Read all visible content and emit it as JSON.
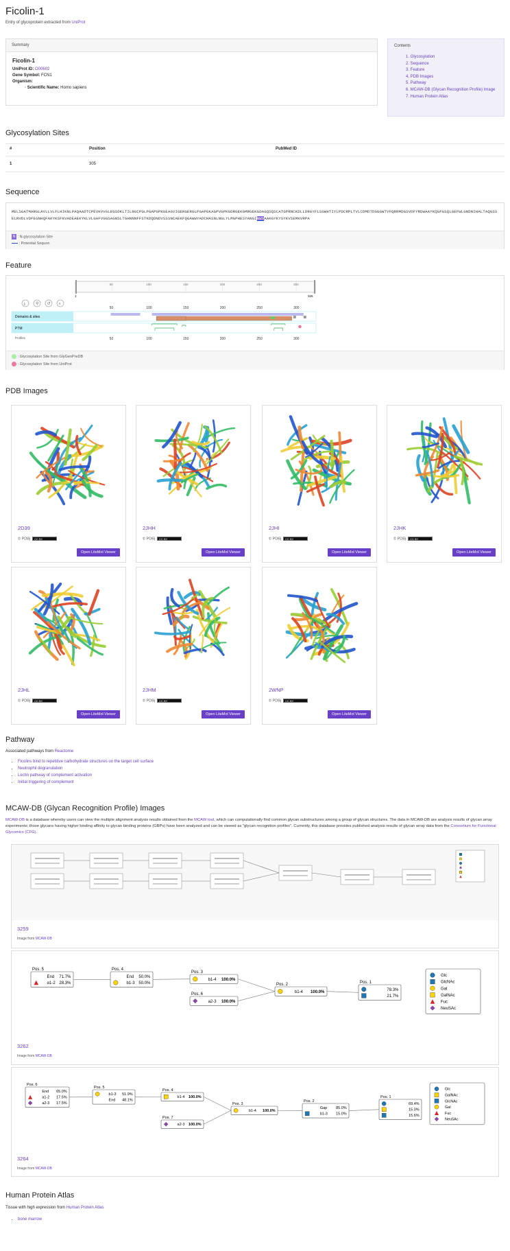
{
  "title": "Ficolin-1",
  "subtitle_prefix": "Entry of glycoprotein extracted from",
  "subtitle_link": "UniProt",
  "summary": {
    "header": "Summary",
    "name": "Ficolin-1",
    "uniprot_label": "UniProt ID:",
    "uniprot_id": "O00602",
    "gene_label": "Gene Symbol:",
    "gene": "FCN1",
    "organism_label": "Organism:",
    "sci_label": "Scientific Name:",
    "sci_name": "Homo sapiens"
  },
  "contents": {
    "header": "Contents",
    "items": [
      "1. Glycosylation",
      "2. Sequence",
      "3. Feature",
      "4. PDB Images",
      "5. Pathway",
      "6. MCAW-DB (Glycan Recognition Profile) Image",
      "7. Human Protein Atlas"
    ]
  },
  "glyco": {
    "heading": "Glycosylation Sites",
    "cols": [
      "#",
      "Position",
      "PubMed ID"
    ],
    "rows": [
      [
        "1",
        "305",
        ""
      ]
    ]
  },
  "sequence": {
    "heading": "Sequence",
    "pre": "MELSGATMARGLAVLLVLFLHIKNLPAQAADTCPEVKVVGLEGSDKLTILRGCPGLPGAPGPKGEAGVIGERGERGLPGAPGKAGPVGPKGDRGEKGMRGEKGDAGQSQSCATGPRNCKDLLDRGYFLSGWHTIYLPDCRPLTVLCDMDTDGGGWTVFQRRMDGSVDFYRDWAAYKQGFGSQLGEFWLGNDNIHALTAQGSSELRVDLVDFEGNHQFAKYKSFKVADEAEKYKLVLGAFVGGSAGNSLTGHNNNFFSTKDQDNDVSSSNCAEKFQGAWWYADCHASNLNGLYLMGPHESYANGINWSAAKGYKYSYKVSEMKVRPA",
    "site": "NWS",
    "post": "AAKGYKYSYKVSEMKVRPA",
    "legend_site": ": N-glycosylation Site",
    "legend_seq": ": Potential Sequon"
  },
  "feature": {
    "heading": "Feature",
    "axis_ticks": [
      "50",
      "100",
      "150",
      "200",
      "250",
      "300"
    ],
    "axis_start": "1",
    "axis_end": "326",
    "tracks": [
      "Domains & sites",
      "PTM"
    ],
    "profiles": "Profiles",
    "legend_gp": ": Glycosylation Site from GlyGenPreDB",
    "legend_up": ": Glycosylation Site from UniProt",
    "colors": {
      "domain": "#d9906a",
      "region": "#b9b9ee",
      "gp": "#66cc66",
      "up": "#e87aa0",
      "track": "#bff0f8"
    }
  },
  "pdb": {
    "heading": "PDB Images",
    "source": "© PDBj",
    "license": "CC BY",
    "button": "Open LiteMol Viewer",
    "entries": [
      "2D39",
      "2JHH",
      "2JHI",
      "2JHK",
      "2JHL",
      "2JHM",
      "2WNP"
    ]
  },
  "pathway": {
    "heading": "Pathway",
    "intro_prefix": "Associated pathways from",
    "intro_link": "Reactome",
    "items": [
      "Ficolins bind to repetitive carbohydrate structures on the target cell surface",
      "Neutrophil degranulation",
      "Lectin pathway of complement activation",
      "Initial triggering of complement"
    ]
  },
  "mcaw": {
    "heading": "MCAW-DB (Glycan Recognition Profile) Images",
    "para": {
      "l1": "MCAW-DB",
      "t1": " is a database whereby users can view the multiple alignment analysis results obtained from the ",
      "l2": "MCAW tool",
      "t2": ", which can computationally find common glycan substructures among a group of glycan structures. The data in MCAW-DB are analysis results of glycan array experiments; those glycans having higher binding affinity to glycan binding proteins (GBPs) have been analyzed and can be viewed as \"glycan recognition profiles\". Currently, this database provides published analysis results of glycan array data from the ",
      "l3": "Consortium for Functional Glycomics (CFG)",
      "t3": "."
    },
    "src_prefix": "Image from",
    "src_link": "MCAW-DB",
    "profiles": [
      {
        "id": "3259"
      },
      {
        "id": "3262"
      },
      {
        "id": "3264"
      }
    ],
    "legend2": [
      "Glc",
      "GlcNAc",
      "Gal",
      "GalNAc",
      "Fuc",
      "NeuSAc"
    ],
    "legend3": [
      "Glc",
      "GalNAc",
      "GlcNAc",
      "Gal",
      "Fuc",
      "Neu5Ac"
    ],
    "p3262": {
      "pos5": {
        "t": "Pos. 5",
        "r": [
          [
            "End",
            "71.7%"
          ],
          [
            "α1-2",
            "28.3%"
          ]
        ]
      },
      "pos4": {
        "t": "Pos. 4",
        "r": [
          [
            "End",
            "50.0%"
          ],
          [
            "b1-3",
            "50.0%"
          ]
        ]
      },
      "pos3": {
        "t": "Pos. 3",
        "r": [
          [
            "b1-4",
            "100.0%"
          ]
        ]
      },
      "pos6": {
        "t": "Pos. 6",
        "r": [
          [
            "a2-3",
            "100.0%"
          ]
        ]
      },
      "pos2": {
        "t": "Pos. 2",
        "r": [
          [
            "b1-4",
            "100.0%"
          ]
        ]
      },
      "pos1": {
        "t": "Pos. 1",
        "r": [
          [
            "",
            "78.3%"
          ],
          [
            "",
            "21.7%"
          ]
        ]
      }
    },
    "p3264": {
      "pos6": {
        "t": "Pos. 6",
        "r": [
          [
            "End",
            "65.0%"
          ],
          [
            "a1-2",
            "17.5%"
          ],
          [
            "a2-3",
            "17.5%"
          ]
        ]
      },
      "pos5": {
        "t": "Pos. 5",
        "r": [
          [
            "b1-3",
            "51.9%"
          ],
          [
            "End",
            "48.1%"
          ]
        ]
      },
      "pos4": {
        "t": "Pos. 4",
        "r": [
          [
            "b1-4",
            "100.0%"
          ]
        ]
      },
      "pos7": {
        "t": "Pos. 7",
        "r": [
          [
            "a2-3",
            "100.0%"
          ]
        ]
      },
      "pos3": {
        "t": "Pos. 3",
        "r": [
          [
            "b1-4",
            "100.0%"
          ]
        ]
      },
      "pos2": {
        "t": "Pos. 2",
        "r": [
          [
            "Gap",
            "85.0%"
          ],
          [
            "b1-3",
            "15.0%"
          ]
        ]
      },
      "pos1": {
        "t": "Pos. 1",
        "r": [
          [
            "",
            "69.4%"
          ],
          [
            "",
            "15.0%"
          ],
          [
            "",
            "15.6%"
          ]
        ]
      }
    }
  },
  "hpa": {
    "heading": "Human Protein Atlas",
    "intro_prefix": "Tissue with high expression from",
    "intro_link": "Human Protein Atlas",
    "items": [
      "bone marrow"
    ]
  }
}
